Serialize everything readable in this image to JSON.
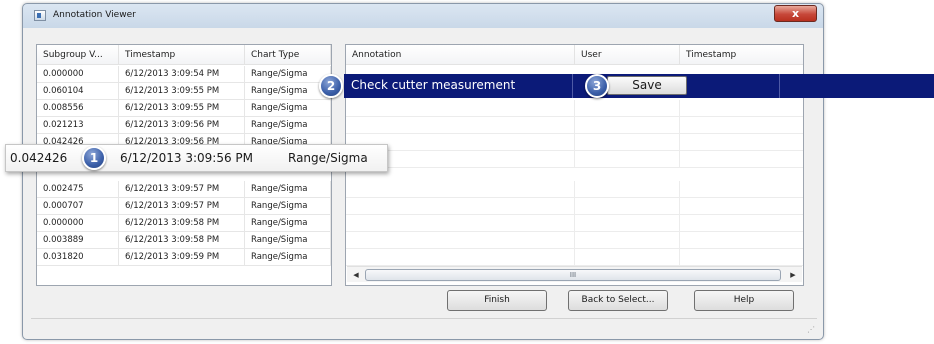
{
  "window": {
    "title": "Annotation Viewer",
    "close_glyph": "x"
  },
  "left_table": {
    "columns": [
      "Subgroup V...",
      "Timestamp",
      "Chart Type"
    ],
    "rows": [
      [
        "0.000000",
        "6/12/2013 3:09:54 PM",
        "Range/Sigma"
      ],
      [
        "0.060104",
        "6/12/2013 3:09:55 PM",
        "Range/Sigma"
      ],
      [
        "0.008556",
        "6/12/2013 3:09:55 PM",
        "Range/Sigma"
      ],
      [
        "0.021213",
        "6/12/2013 3:09:56 PM",
        "Range/Sigma"
      ],
      [
        "0.042426",
        "6/12/2013 3:09:56 PM",
        "Range/Sigma"
      ],
      [
        "",
        "",
        ""
      ],
      [
        "0.002475",
        "6/12/2013 3:09:57 PM",
        "Range/Sigma"
      ],
      [
        "0.000707",
        "6/12/2013 3:09:57 PM",
        "Range/Sigma"
      ],
      [
        "0.000000",
        "6/12/2013 3:09:58 PM",
        "Range/Sigma"
      ],
      [
        "0.003889",
        "6/12/2013 3:09:58 PM",
        "Range/Sigma"
      ],
      [
        "0.031820",
        "6/12/2013 3:09:59 PM",
        "Range/Sigma"
      ]
    ]
  },
  "right_table": {
    "columns": [
      "Annotation",
      "User",
      "Timestamp"
    ],
    "selected_row": {
      "annotation": "Check cutter measurement",
      "save_label": "Save"
    },
    "scroll_grip": "III"
  },
  "callouts": {
    "one": "1",
    "two": "2",
    "three": "3",
    "zoom_row": {
      "value": "0.042426",
      "timestamp": "6/12/2013 3:09:56 PM",
      "chart_type": "Range/Sigma"
    }
  },
  "buttons": {
    "finish": "Finish",
    "back": "Back to Select...",
    "help": "Help"
  },
  "colors": {
    "selection": "#0b1a78",
    "badge": "#3a5ea8",
    "close": "#c7483a"
  },
  "icons": {
    "scroll_left": "left-arrow-icon",
    "scroll_right": "right-arrow-icon",
    "resize": "resize-grip-icon",
    "app": "app-window-icon"
  }
}
